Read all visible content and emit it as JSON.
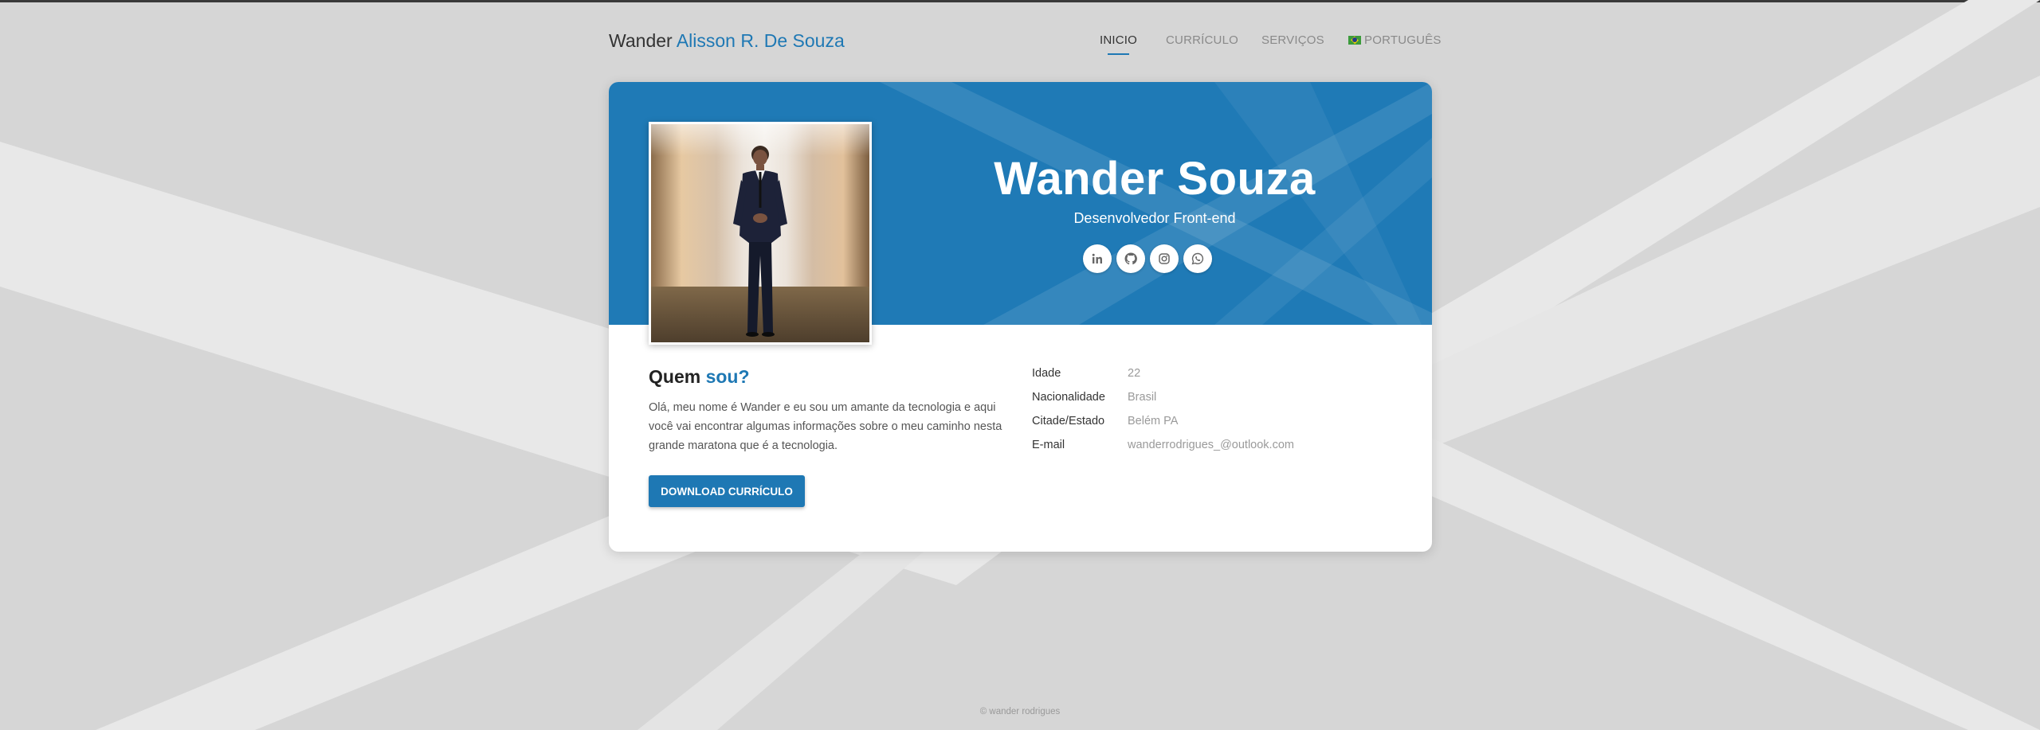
{
  "brand": {
    "first": "Wander",
    "rest": "Alisson R. De Souza"
  },
  "nav": {
    "items": [
      {
        "label": "INICIO"
      },
      {
        "label": "CURRÍCULO"
      },
      {
        "label": "SERVIÇOS"
      }
    ],
    "language": {
      "label": "PORTUGUÊS",
      "icon": "brazil-flag-icon"
    }
  },
  "hero": {
    "name": "Wander Souza",
    "role": "Desenvolvedor Front-end",
    "socials": [
      {
        "icon": "linkedin-icon"
      },
      {
        "icon": "github-icon"
      },
      {
        "icon": "instagram-icon"
      },
      {
        "icon": "whatsapp-icon"
      }
    ]
  },
  "about": {
    "title_plain": "Quem",
    "title_accent": "sou?",
    "text": "Olá, meu nome é Wander e eu sou um amante da tecnologia e aqui você vai encontrar algumas informações sobre o meu caminho nesta grande maratona que é a tecnologia.",
    "button_label": "DOWNLOAD CURRÍCULO"
  },
  "info": [
    {
      "label": "Idade",
      "value": "22"
    },
    {
      "label": "Nacionalidade",
      "value": "Brasil"
    },
    {
      "label": "Citade/Estado",
      "value": "Belém PA"
    },
    {
      "label": "E-mail",
      "value": "wanderrodrigues_@outlook.com"
    }
  ],
  "footer": {
    "text": "© wander rodrigues"
  },
  "colors": {
    "accent": "#1e78b4",
    "header": "#1f7ab6",
    "background": "#d6d6d6"
  }
}
